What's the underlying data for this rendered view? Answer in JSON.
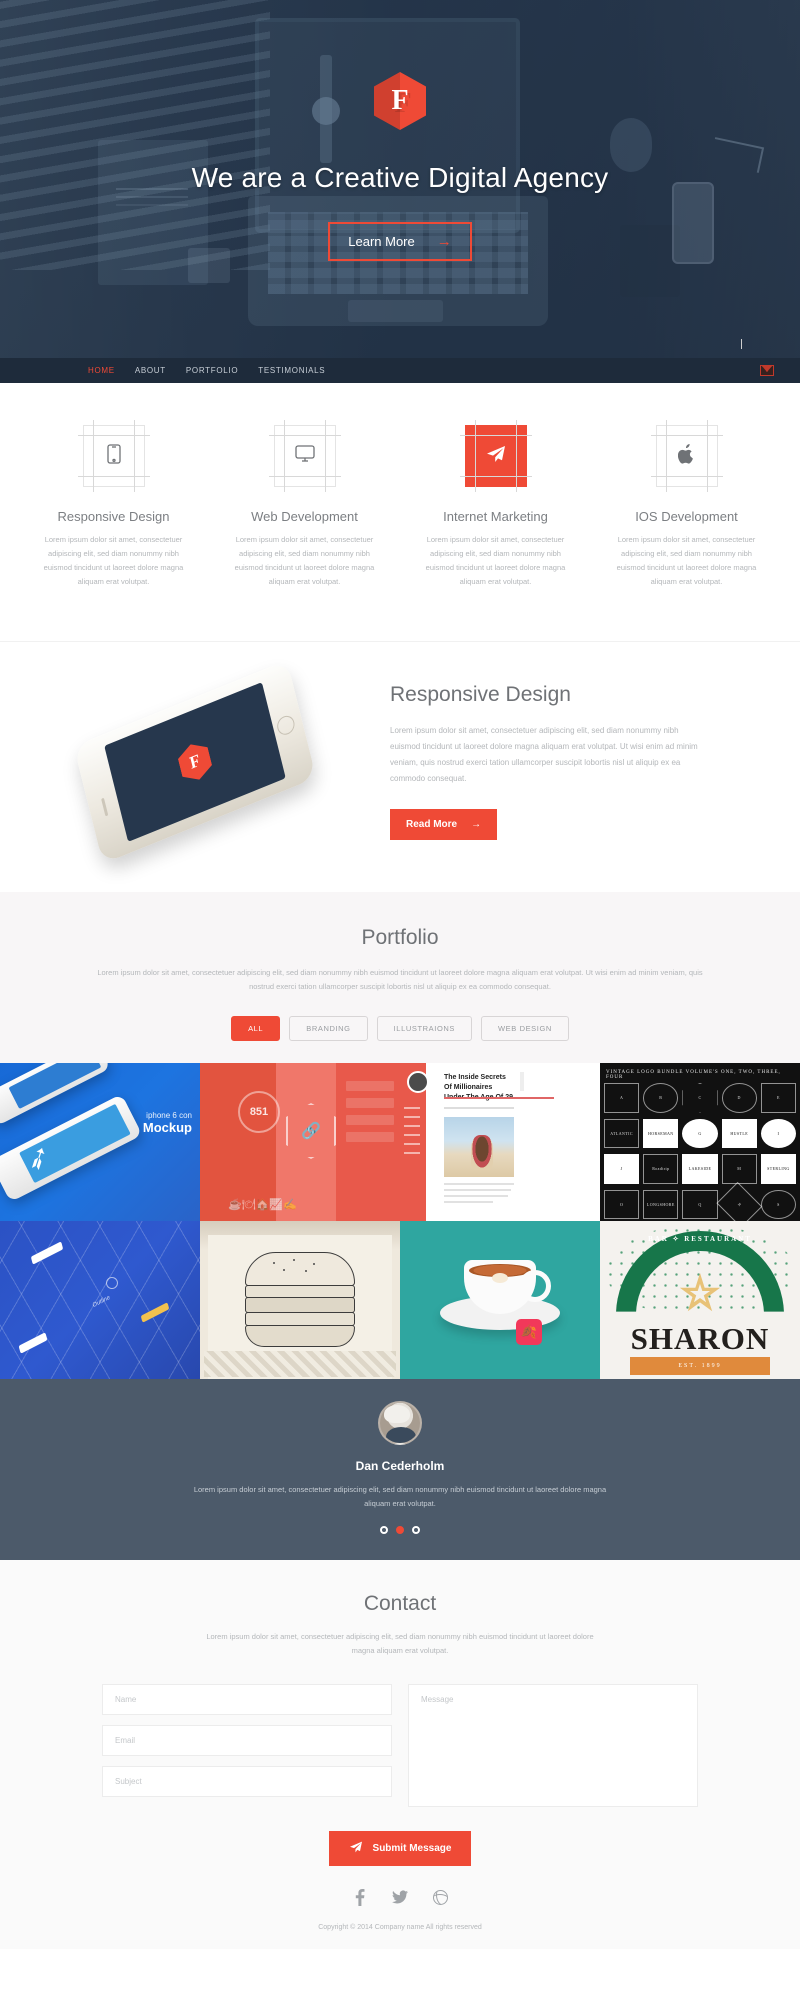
{
  "hero": {
    "logo_letter": "F",
    "logo_icon": "hexagon-logo-icon",
    "title": "We are a Creative Digital Agency",
    "cta_label": "Learn More",
    "cta_arrow": "→"
  },
  "nav": {
    "items": [
      {
        "label": "HOME",
        "active": true
      },
      {
        "label": "ABOUT",
        "active": false
      },
      {
        "label": "PORTFOLIO",
        "active": false
      },
      {
        "label": "TESTIMONIALS",
        "active": false
      }
    ],
    "mail_icon": "mail-icon"
  },
  "services": {
    "items": [
      {
        "icon": "mobile-phone-icon",
        "title": "Responsive Design",
        "text": "Lorem ipsum dolor sit amet, consectetuer adipiscing elit, sed diam nonummy nibh euismod tincidunt ut laoreet dolore magna aliquam erat volutpat.",
        "highlighted": false
      },
      {
        "icon": "desktop-monitor-icon",
        "title": "Web Development",
        "text": "Lorem ipsum dolor sit amet, consectetuer adipiscing elit, sed diam nonummy nibh euismod tincidunt ut laoreet dolore magna aliquam erat volutpat.",
        "highlighted": false
      },
      {
        "icon": "paper-plane-icon",
        "title": "Internet Marketing",
        "text": "Lorem ipsum dolor sit amet, consectetuer adipiscing elit, sed diam nonummy nibh euismod tincidunt ut laoreet dolore magna aliquam erat volutpat.",
        "highlighted": true
      },
      {
        "icon": "apple-icon",
        "title": "IOS Development",
        "text": "Lorem ipsum dolor sit amet, consectetuer adipiscing elit, sed diam nonummy nibh euismod tincidunt ut laoreet dolore magna aliquam erat volutpat.",
        "highlighted": false
      }
    ]
  },
  "responsive_section": {
    "phone_logo_letter": "F",
    "title": "Responsive Design",
    "text": "Lorem ipsum dolor sit amet, consectetuer adipiscing elit, sed diam nonummy nibh euismod tincidunt ut laoreet dolore magna aliquam erat volutpat. Ut wisi enim ad minim veniam, quis nostrud exerci tation ullamcorper suscipit lobortis nisl ut aliquip ex ea commodo consequat.",
    "button_label": "Read More",
    "button_arrow": "→"
  },
  "portfolio": {
    "title": "Portfolio",
    "text": "Lorem ipsum dolor sit amet, consectetuer adipiscing elit, sed diam nonummy nibh euismod tincidunt ut laoreet dolore magna aliquam erat volutpat. Ut wisi enim ad minim veniam, quis nostrud exerci tation ullamcorper suscipit lobortis nisl ut aliquip ex ea commodo consequat.",
    "filters": [
      {
        "label": "ALL",
        "active": true
      },
      {
        "label": "BRANDING",
        "active": false
      },
      {
        "label": "ILLUSTRAIONS",
        "active": false
      },
      {
        "label": "WEB DESIGN",
        "active": false
      }
    ],
    "items": [
      {
        "name": "iphone-twitter-mockup",
        "caption_small": "iphone 6 con",
        "caption_large": "Mockup"
      },
      {
        "name": "coral-app-ui",
        "ring_value": "851"
      },
      {
        "name": "blog-article-preview",
        "headline": "The Inside Secrets Of Millionaires Under The Age Of 29"
      },
      {
        "name": "vintage-logo-bundle",
        "header": "VINTAGE LOGO BUNDLE   VOLUME'S ONE, TWO, THREE, FOUR"
      },
      {
        "name": "blueprint-isometric",
        "label": "Outline"
      },
      {
        "name": "burger-sketch"
      },
      {
        "name": "coffee-cup-teal"
      },
      {
        "name": "sharon-bar-restaurant",
        "arc_text": "BAR ✧ RESTAURANT",
        "brand": "SHARON",
        "ribbon": "EST. 1899"
      }
    ]
  },
  "testimonial": {
    "avatar": "avatar",
    "name": "Dan Cederholm",
    "text": "Lorem ipsum dolor sit amet, consectetuer adipiscing elit, sed diam nonummy nibh euismod tincidunt ut laoreet dolore magna aliquam erat volutpat.",
    "dots": [
      {
        "active": false
      },
      {
        "active": true
      },
      {
        "active": false
      }
    ]
  },
  "contact": {
    "title": "Contact",
    "text": "Lorem ipsum dolor sit amet, consectetuer adipiscing elit, sed diam nonummy nibh euismod tincidunt ut laoreet dolore magna aliquam erat volutpat.",
    "name_placeholder": "Name",
    "name_value": "",
    "email_placeholder": "Email",
    "email_value": "",
    "subject_placeholder": "Subject",
    "subject_value": "",
    "message_placeholder": "Message",
    "message_value": "",
    "submit_label": "Submit Message"
  },
  "footer": {
    "social": [
      {
        "icon": "facebook-icon",
        "glyph": "f"
      },
      {
        "icon": "twitter-icon",
        "glyph": "❦"
      },
      {
        "icon": "dribbble-icon",
        "glyph": ""
      }
    ],
    "copyright": "Copyright © 2014 Company name All rights reserved"
  },
  "colors": {
    "accent": "#ef4a36",
    "hero_bg": "#2b3a4d",
    "navbar_bg": "#1e2b3b",
    "testimonial_bg": "#4c5a6a",
    "portfolio_bg": "#f8f6f7"
  }
}
